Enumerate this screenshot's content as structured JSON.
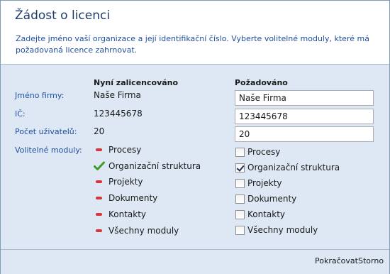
{
  "header": {
    "title": "Žádost o licenci",
    "description": "Zadejte jméno vaší organizace a její identifikační číslo. Vyberte volitelné moduly, které má požadovaná licence zahrnovat."
  },
  "columns": {
    "current": "Nyní zalicencováno",
    "requested": "Požadováno"
  },
  "fields": {
    "company_name": {
      "label": "Jméno firmy:",
      "current": "Naše Firma",
      "requested": "Naše Firma"
    },
    "ico": {
      "label": "IČ:",
      "current": "123445678",
      "requested": "123445678"
    },
    "user_count": {
      "label": "Počet uživatelů:",
      "current": "20",
      "requested": "20"
    }
  },
  "modules_label": "Volitelné moduly:",
  "modules": [
    {
      "name": "Procesy",
      "current_icon": "minus-icon",
      "requested_checked": false
    },
    {
      "name": "Organizační struktura",
      "current_icon": "checkmark-icon",
      "requested_checked": true
    },
    {
      "name": "Projekty",
      "current_icon": "minus-icon",
      "requested_checked": false
    },
    {
      "name": "Dokumenty",
      "current_icon": "minus-icon",
      "requested_checked": false
    },
    {
      "name": "Kontakty",
      "current_icon": "minus-icon",
      "requested_checked": false
    },
    {
      "name": "Všechny moduly",
      "current_icon": "minus-icon",
      "requested_checked": false
    }
  ],
  "footer": {
    "continue_label": "Pokračovat",
    "cancel_label": "Storno"
  },
  "colors": {
    "accent_label": "#1f4e9b",
    "panel_bg": "#dde8f4",
    "minus": "#d9343a",
    "check": "#3f9a2a"
  }
}
